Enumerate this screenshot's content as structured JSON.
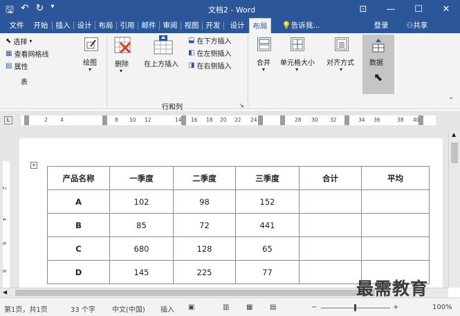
{
  "window": {
    "title": "文档2 - Word",
    "save_icon": "save-icon",
    "undo_icon": "undo-icon",
    "redo_icon": "redo-icon",
    "qat_more": "customize-qat-icon",
    "ribbon_display": "ribbon-display-icon",
    "minimize": "—",
    "maximize": "☐",
    "close": "✕"
  },
  "tabs": [
    {
      "label": "文件"
    },
    {
      "label": "开始"
    },
    {
      "label": "插入"
    },
    {
      "label": "设计"
    },
    {
      "label": "布局"
    },
    {
      "label": "引用"
    },
    {
      "label": "邮件"
    },
    {
      "label": "审阅"
    },
    {
      "label": "视图"
    },
    {
      "label": "开发"
    },
    {
      "label": "设计"
    },
    {
      "label": "布局"
    }
  ],
  "tell_me": "告诉我...",
  "login": "登录",
  "share": "共享",
  "ribbon": {
    "table_group": {
      "select": "选择",
      "gridlines": "查看网格线",
      "properties": "属性",
      "label": "表"
    },
    "draw": "绘图",
    "delete": "删除",
    "insert_above": "在上方插入",
    "insert_below": "在下方插入",
    "insert_left": "在左侧插入",
    "insert_right": "在右侧插入",
    "rows_cols_label": "行和列",
    "merge": "合并",
    "cell_size": "单元格大小",
    "alignment": "对齐方式",
    "data": "数据"
  },
  "ruler": {
    "ticks": [
      "2",
      "4",
      "8",
      "10",
      "12",
      "14",
      "16",
      "18",
      "20",
      "22",
      "24",
      "28",
      "30",
      "32",
      "34",
      "36",
      "38",
      "40"
    ]
  },
  "vruler": {
    "ticks": [
      "2",
      "4",
      "6",
      "8"
    ]
  },
  "table": {
    "headers": [
      "产品名称",
      "一季度",
      "二季度",
      "三季度",
      "合计",
      "平均"
    ],
    "rows": [
      [
        "A",
        "102",
        "98",
        "152",
        "",
        ""
      ],
      [
        "B",
        "85",
        "72",
        "441",
        "",
        ""
      ],
      [
        "C",
        "680",
        "128",
        "65",
        "",
        ""
      ],
      [
        "D",
        "145",
        "225",
        "77",
        "",
        ""
      ]
    ]
  },
  "status": {
    "page": "第1页，共1页",
    "words": "33 个字",
    "language": "中文(中国)",
    "mode": "插入",
    "zoom": "100%"
  },
  "watermark": "最需教育"
}
